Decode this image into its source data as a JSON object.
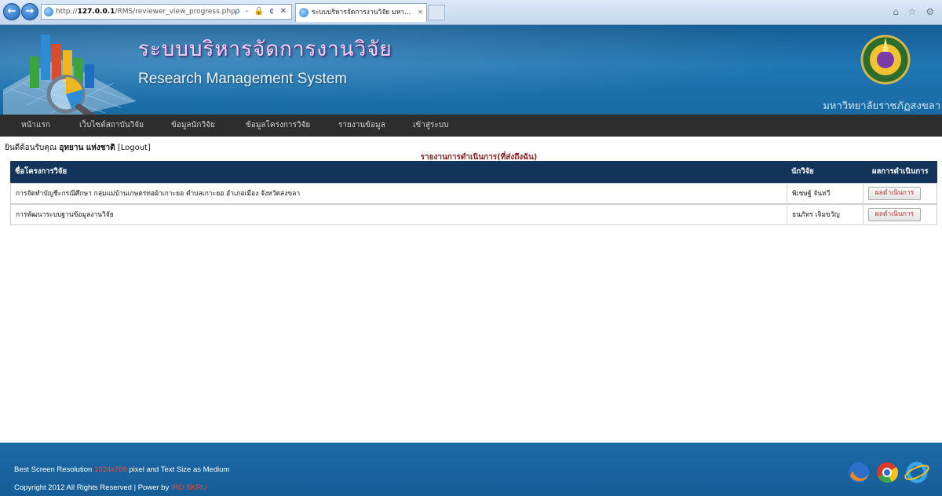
{
  "browser": {
    "url_prefix": "http://",
    "url_host": "127.0.0.1",
    "url_path": "/RMS/reviewer_view_progress.php",
    "url_tools": "ρ - 🔒 ¢ ✕",
    "tab_title": "ระบบบริหารจัดการงานวิจัย มหา...",
    "tab_close": "×",
    "back_label": "←",
    "forward_label": "→",
    "right_tools": "⌂ ☆ ⚙"
  },
  "header": {
    "title_th": "ระบบบริหารจัดการงานวิจัย",
    "title_en": "Research Management System",
    "university": "มหาวิทยาลัยราชภัฏสงขลา"
  },
  "nav": {
    "items": [
      {
        "label": "หน้าแรก"
      },
      {
        "label": "เว็บไซต์สถาบันวิจัย"
      },
      {
        "label": "ข้อมูลนักวิจัย"
      },
      {
        "label": "ข้อมูลโครงการวิจัย"
      },
      {
        "label": "รายงานข้อมูล"
      },
      {
        "label": "เข้าสู่ระบบ"
      }
    ]
  },
  "welcome": {
    "prefix": "ยินดีต้อนรับคุณ",
    "user": "อุทยาน แห่งชาติ",
    "logout": "[Logout]"
  },
  "report": {
    "title": "รายงานการดำเนินการ(ที่ส่งถึงฉัน)",
    "columns": {
      "project": "ชื่อโครงการวิจัย",
      "researcher": "นักวิจัย",
      "result": "ผลการดำเนินการ"
    },
    "rows": [
      {
        "project": "การจัดทำบัญชีะกรณีศึกษา กลุ่มแม่บ้านเกษตรทอผ้าเกาะยอ ตำบลเกาะยอ อำเภอเมือง จังหวัดสงขลา",
        "researcher": "พิเชษฐ์ จันทวี",
        "action": "ผลดำเนินการ"
      },
      {
        "project": "การพัฒนาระบบฐานข้อมูลงานวิจัย",
        "researcher": "ธนภัทร เจิมขวัญ",
        "action": "ผลดำเนินการ"
      }
    ]
  },
  "footer": {
    "line1_prefix": "Best Screen Resolution",
    "line1_highlight": "1024x768",
    "line1_suffix": "pixel and Text Size as Medium",
    "line2_prefix": "Copyright 2012 All Rights Reserved | Power by",
    "line2_highlight": "IRD SKRU"
  },
  "colors": {
    "header_blue": "#1f76b4",
    "nav_dark": "#2d2d2d",
    "table_head": "#13345a",
    "report_title": "#8a1d1d",
    "button_text": "#c0392b",
    "footer_blue": "#1b6aa8"
  },
  "icons": [
    "back-icon",
    "forward-icon",
    "ie-icon",
    "home-icon",
    "star-icon",
    "gear-icon",
    "seal-icon",
    "firefox-icon",
    "chrome-icon",
    "ie8-icon"
  ]
}
